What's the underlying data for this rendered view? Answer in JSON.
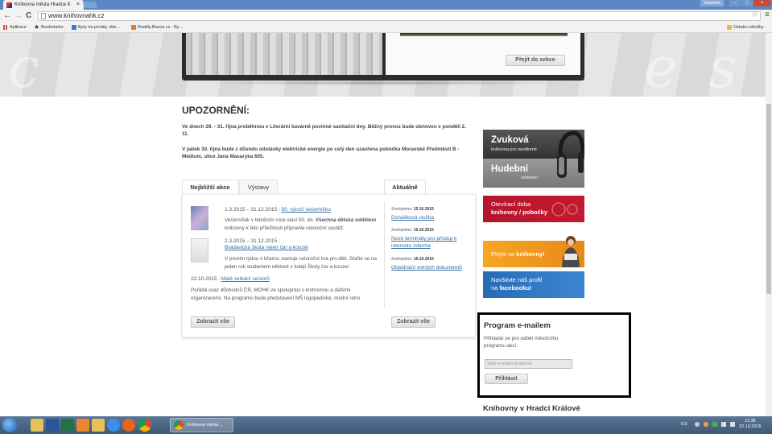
{
  "browser": {
    "tab_title": "Knihovna města Hradce K",
    "tab_close": "×",
    "user_name": "Vladimíra",
    "window_controls": [
      "–",
      "□",
      "×"
    ],
    "back": "←",
    "forward": "→",
    "reload": "C",
    "url": "www.knihovnahk.cz",
    "menu_glyph": "≡",
    "star_glyph": "☆",
    "bookmarks": [
      {
        "label": "Aplikace",
        "icon": "apps-grid-icon",
        "color": "#d24c3e"
      },
      {
        "label": "Bookmarks",
        "icon": "star-icon",
        "color": "#555555"
      },
      {
        "label": "Byty na prodej, obe…",
        "icon": "site-favicon-icon",
        "color": "#3a7bd5"
      },
      {
        "label": "Reality.Bazos.cz - By…",
        "icon": "site-favicon-icon",
        "color": "#e77b26"
      }
    ],
    "other_bookmarks": "Ostatní záložky"
  },
  "banner": {
    "ghost_letters": "ci e so lo ci",
    "section_button": "Přejít do sekce"
  },
  "notice": {
    "title": "UPOZORNĚNÍ:",
    "paragraph1": "Ve dnech 29. - 31. října proběhnou v Literární kavárně povinné sanitační dny. Běžný provoz bude obnoven v pondělí 2. 11.",
    "paragraph2": "V pátek 30. října bude z důvodu odstávky elektrické energie po celý den uzavřena pobočka Moravské Předměstí B - Médium, ulice Jana Masaryka 605."
  },
  "tabs": {
    "nearest": "Nejbližší akce",
    "exhibitions": "Výstavy",
    "news": "Aktuálně"
  },
  "events": [
    {
      "date": "1.3.2015 – 31.12.2015",
      "sep": "|",
      "title": "50. výročí večerníčku",
      "text_pre": "Večerníček v letošním roce slaví 50. let. ",
      "text_bold": "Všechna dětská oddělení",
      "text_post": " knihovny k této příležitosti připravila celoroční soutěž."
    },
    {
      "date": "2.3.2015 – 31.12.2015",
      "sep": "|",
      "title": "Bradavická škola nejen čar a kouzel",
      "text": "V prvním týdnu v březnu startuje celoroční hra pro děti. Stařte se na jeden rok studentem některé z kolejí Školy čar a kouzel"
    },
    {
      "date": "22.10.2015",
      "sep": "|",
      "title": "Malé setkání seniorů",
      "text": "Pořádá svaz důchodců ČR, MOHK ve spolupráci s knihovnou a dalšími organizacemi. Na programu bude představení MŠ logopedické, módní retro"
    }
  ],
  "news": [
    {
      "label": "Zveřejněno:",
      "date": "15.10.2015",
      "title": "Donášková služba"
    },
    {
      "label": "Zveřejněno:",
      "date": "15.10.2015",
      "title": "Nové terminály pro přístup k internetu zdarma"
    },
    {
      "label": "Zveřejněno:",
      "date": "15.10.2015",
      "title": "Objednání volných dokumentů"
    }
  ],
  "show_all_events": "Zobrazit vše",
  "show_all_news": "Zobrazit vše",
  "sidebar": {
    "zvukova": "Zvuková",
    "zvukova_sub": "knihovna pro nevidomé",
    "hudebni": "Hudební",
    "hudebni_sub": "oddělení",
    "oteviraci1": "Otevírací doba",
    "oteviraci2": "knihovny / pobočky",
    "ptejte_pre": "Ptejte se ",
    "ptejte_bold": "knihovny!",
    "fb1": "Navštivte náš profil",
    "fb2_pre": "na ",
    "fb2_bold": "facebooku!",
    "email_title": "Program e-mailem",
    "email_text": "Přihlaste se pro odběr měsíčního programu akcí.",
    "email_placeholder": "Vaše e-mailová adresa",
    "email_button": "Přihlásit",
    "libraries_heading": "Knihovny v Hradci Králové"
  },
  "taskbar": {
    "active_window": "Knihovna města ...",
    "lang": "CS",
    "time": "11:38",
    "date": "22.10.2015"
  }
}
